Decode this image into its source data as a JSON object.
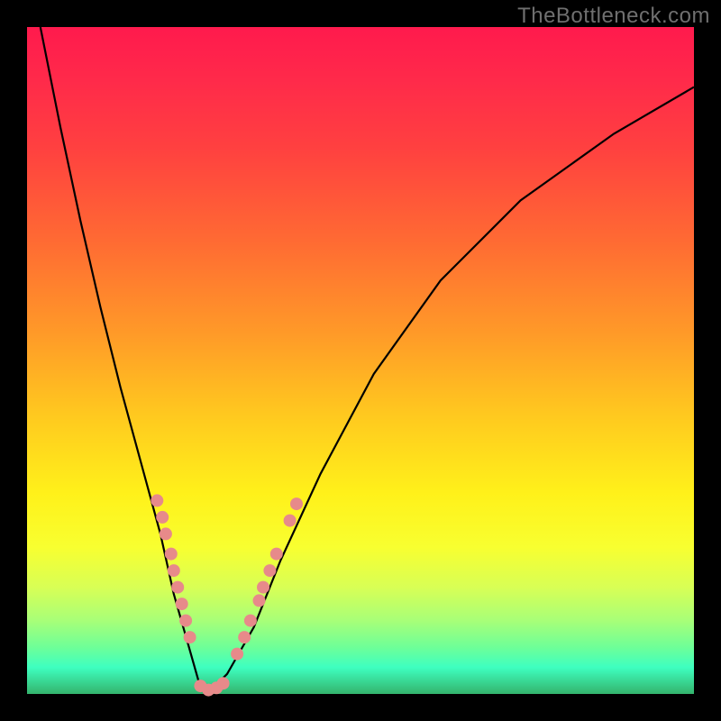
{
  "watermark": "TheBottleneck.com",
  "colors": {
    "page_bg": "#000000",
    "curve_stroke": "#000000",
    "dot_fill": "#e78a8a",
    "gradient_stops": [
      "#ff1a4d",
      "#ff2a4a",
      "#ff4040",
      "#ff6a33",
      "#ff9a28",
      "#ffc81f",
      "#fff11a",
      "#f8ff30",
      "#d8ff55",
      "#a8ff78",
      "#6eff98",
      "#3effc0",
      "#34b36c"
    ]
  },
  "chart_data": {
    "type": "line",
    "title": "",
    "xlabel": "",
    "ylabel": "",
    "xlim": [
      0,
      100
    ],
    "ylim": [
      0,
      100
    ],
    "grid": false,
    "legend": false,
    "series": [
      {
        "name": "black-v-curve",
        "x": [
          2,
          5,
          8,
          11,
          14,
          17,
          20,
          22,
          24,
          25.7,
          27.5,
          30,
          34,
          38,
          44,
          52,
          62,
          74,
          88,
          100
        ],
        "y": [
          100,
          85,
          71,
          58,
          46,
          35,
          24,
          15,
          8,
          2,
          0.5,
          3,
          10,
          20,
          33,
          48,
          62,
          74,
          84,
          91
        ]
      }
    ],
    "dot_series": [
      {
        "name": "pink-dots-left-branch",
        "points": [
          {
            "x": 19.5,
            "y": 29
          },
          {
            "x": 20.3,
            "y": 26.5
          },
          {
            "x": 20.8,
            "y": 24
          },
          {
            "x": 21.6,
            "y": 21
          },
          {
            "x": 22.0,
            "y": 18.5
          },
          {
            "x": 22.6,
            "y": 16
          },
          {
            "x": 23.2,
            "y": 13.5
          },
          {
            "x": 23.8,
            "y": 11
          },
          {
            "x": 24.4,
            "y": 8.5
          }
        ]
      },
      {
        "name": "pink-dots-valley",
        "points": [
          {
            "x": 26.0,
            "y": 1.2
          },
          {
            "x": 27.2,
            "y": 0.6
          },
          {
            "x": 28.4,
            "y": 0.9
          },
          {
            "x": 29.4,
            "y": 1.6
          }
        ]
      },
      {
        "name": "pink-dots-right-branch",
        "points": [
          {
            "x": 31.5,
            "y": 6
          },
          {
            "x": 32.6,
            "y": 8.5
          },
          {
            "x": 33.5,
            "y": 11
          },
          {
            "x": 34.8,
            "y": 14
          },
          {
            "x": 35.4,
            "y": 16
          },
          {
            "x": 36.4,
            "y": 18.5
          },
          {
            "x": 37.4,
            "y": 21
          },
          {
            "x": 39.4,
            "y": 26
          },
          {
            "x": 40.4,
            "y": 28.5
          }
        ]
      }
    ]
  }
}
